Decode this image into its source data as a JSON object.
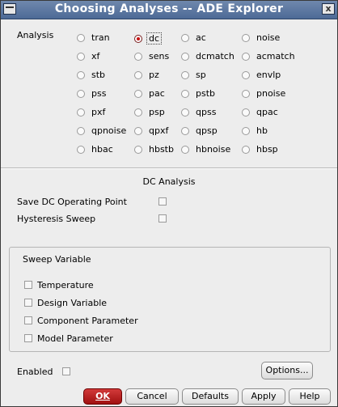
{
  "window": {
    "title": "Choosing Analyses -- ADE Explorer",
    "close_glyph": "x"
  },
  "analysis": {
    "label": "Analysis",
    "options": [
      [
        "tran",
        "dc",
        "ac",
        "noise"
      ],
      [
        "xf",
        "sens",
        "dcmatch",
        "acmatch"
      ],
      [
        "stb",
        "pz",
        "sp",
        "envlp"
      ],
      [
        "pss",
        "pac",
        "pstb",
        "pnoise"
      ],
      [
        "pxf",
        "psp",
        "qpss",
        "qpac"
      ],
      [
        "qpnoise",
        "qpxf",
        "qpsp",
        "hb"
      ],
      [
        "hbac",
        "hbstb",
        "hbnoise",
        "hbsp"
      ]
    ],
    "selected": "dc"
  },
  "dc_section": {
    "title": "DC Analysis",
    "save_dc_op": "Save DC Operating Point",
    "hysteresis": "Hysteresis Sweep"
  },
  "sweep": {
    "title": "Sweep Variable",
    "items": [
      "Temperature",
      "Design Variable",
      "Component Parameter",
      "Model Parameter"
    ]
  },
  "enabled_label": "Enabled",
  "buttons": {
    "options": "Options...",
    "ok": "OK",
    "cancel": "Cancel",
    "defaults": "Defaults",
    "apply": "Apply",
    "help": "Help"
  }
}
